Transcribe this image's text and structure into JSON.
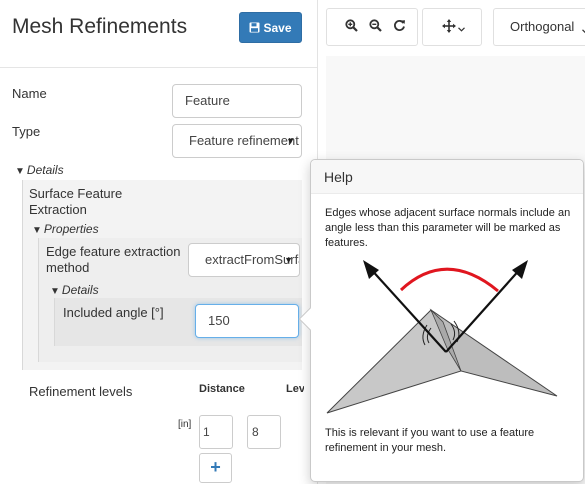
{
  "panel": {
    "title": "Mesh Refinements",
    "save_label": "Save"
  },
  "form": {
    "name_label": "Name",
    "name_value": "Feature",
    "type_label": "Type",
    "type_value": "Feature refinement",
    "details_label": "Details",
    "surface_feature_label": "Surface Feature Extraction",
    "properties_label": "Properties",
    "edge_method_label": "Edge feature extraction method",
    "edge_method_value": "extractFromSurface",
    "inner_details_label": "Details",
    "included_angle_label": "Included angle [°]",
    "included_angle_value": "150",
    "refinement_levels_label": "Refinement levels",
    "distance_header": "Distance",
    "level_header": "Level",
    "unit_label": "[in]",
    "distance_value": "1",
    "level_value": "8"
  },
  "toolbar": {
    "projection_value": "Orthogonal"
  },
  "help": {
    "title": "Help",
    "text_1": "Edges whose adjacent surface normals include an angle less than this parameter will be marked as features.",
    "text_2": "This is relevant if you want to use a feature refinement in your mesh."
  },
  "colors": {
    "primary": "#337ab7",
    "angle_arc": "#e0161f",
    "surface_fill": "#c8c8c8"
  },
  "icons": [
    "save-icon",
    "zoom-in-icon",
    "zoom-out-icon",
    "refresh-icon",
    "move-icon",
    "chevron-down-icon",
    "caret-down-icon",
    "expand-triangle-icon",
    "plus-icon"
  ]
}
